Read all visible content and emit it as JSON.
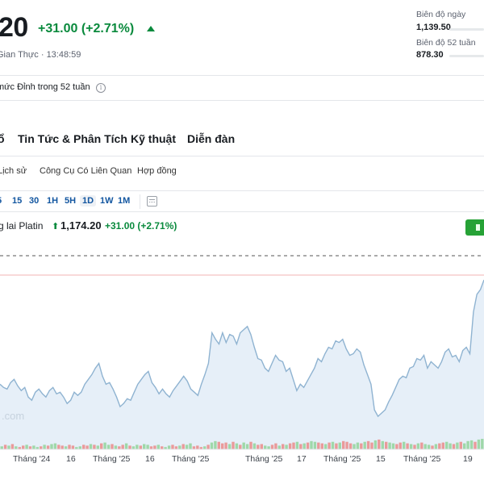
{
  "header": {
    "price_fragment": "20",
    "change": "+31.00 (+2.71%)",
    "realtime_label": "Gian Thực · 13:48:59",
    "day_range": {
      "label": "Biên độ ngày",
      "value": "1,139.50"
    },
    "week52_range": {
      "label": "Biên độ 52 tuần",
      "value": "878.30"
    },
    "high_notice": "mức Đỉnh trong 52 tuần",
    "info_icon_glyph": "i"
  },
  "main_tabs": [
    "ổ",
    "Tin Tức & Phân Tích",
    "Kỹ thuật",
    "Diễn đàn"
  ],
  "sub_tabs": [
    "Lịch sử",
    "Công Cụ Có Liên Quan",
    "Hợp đồng"
  ],
  "intervals": [
    {
      "label": "5",
      "active": false
    },
    {
      "label": "15",
      "active": false
    },
    {
      "label": "30",
      "active": false
    },
    {
      "label": "1H",
      "active": false
    },
    {
      "label": "5H",
      "active": false
    },
    {
      "label": "1D",
      "active": true
    },
    {
      "label": "1W",
      "active": false
    },
    {
      "label": "1M",
      "active": false
    }
  ],
  "chart_legend": {
    "name": "g lai Platin",
    "arrow": "⬆",
    "price": "1,174.20",
    "change": "+31.00 (+2.71%)"
  },
  "watermark": ".com",
  "colors": {
    "up": "#0a8a3d",
    "line": "#8fb3d1",
    "area": "#e6eff8",
    "vol_up": "#9fd8a9",
    "vol_down": "#ea9a9a",
    "button": "#26a236"
  },
  "chart_data": {
    "type": "area",
    "x_tick_labels": [
      "Tháng '24",
      "16",
      "Tháng '25",
      "16",
      "Tháng '25",
      "Tháng '25",
      "17",
      "Tháng '25",
      "15",
      "Tháng '25",
      "19"
    ],
    "values": [
      52,
      50,
      49,
      53,
      55,
      51,
      48,
      50,
      44,
      42,
      47,
      49,
      46,
      44,
      48,
      50,
      46,
      47,
      44,
      40,
      42,
      47,
      45,
      47,
      52,
      55,
      58,
      62,
      65,
      57,
      52,
      53,
      49,
      44,
      38,
      40,
      43,
      42,
      47,
      52,
      55,
      58,
      60,
      53,
      50,
      46,
      49,
      46,
      44,
      48,
      51,
      54,
      57,
      54,
      49,
      47,
      45,
      52,
      58,
      65,
      84,
      80,
      77,
      84,
      78,
      83,
      82,
      77,
      84,
      86,
      88,
      83,
      75,
      68,
      67,
      62,
      60,
      65,
      70,
      67,
      66,
      60,
      62,
      55,
      48,
      52,
      50,
      54,
      58,
      62,
      68,
      66,
      71,
      75,
      74,
      79,
      78,
      80,
      74,
      70,
      71,
      74,
      72,
      64,
      58,
      52,
      36,
      32,
      34,
      36,
      41,
      45,
      50,
      55,
      57,
      56,
      62,
      63,
      68,
      67,
      70,
      62,
      66,
      64,
      62,
      66,
      72,
      74,
      69,
      70,
      66,
      73,
      75,
      71,
      97,
      108,
      111,
      117
    ],
    "y_range": [
      25,
      120
    ],
    "volume_colors": "g,r,g,r,g,r,r,g,r,g,g,r,g,r,g,g,r,r,g,r,r,g,g,r,r,g,r,g,r,g,g,r,g,r,r,g,r,g,g,r,g,g,r,r,g,r,g,g,r,r,g,r,g,g,r,r,r,g,r,g,g,r,r,r,g,r,g,r,g,g,r,g,r,r,g,g,r,r,g,r,g,r,r,g,r,g,r,g,g,r,r,g,r,g,r,g,r,r,r,g,g,r,g,r,r,g,r,g,r,g,g,r,r,g,r,g,r,g,r,g,g,r,g,r,r,g,g,r,g,r,g,g,g,r,g,g,g",
    "volumes": [
      4,
      6,
      5,
      7,
      4,
      3,
      5,
      6,
      4,
      5,
      3,
      4,
      6,
      5,
      7,
      8,
      6,
      5,
      4,
      6,
      5,
      3,
      4,
      6,
      5,
      7,
      6,
      5,
      8,
      9,
      6,
      7,
      5,
      4,
      6,
      8,
      5,
      4,
      6,
      5,
      7,
      6,
      4,
      5,
      6,
      4,
      3,
      5,
      6,
      4,
      5,
      7,
      6,
      8,
      4,
      5,
      3,
      4,
      6,
      9,
      11,
      10,
      8,
      9,
      7,
      10,
      8,
      6,
      9,
      7,
      10,
      8,
      6,
      7,
      5,
      4,
      6,
      8,
      5,
      7,
      6,
      8,
      9,
      10,
      7,
      8,
      9,
      11,
      10,
      9,
      8,
      7,
      9,
      10,
      8,
      9,
      11,
      10,
      8,
      7,
      9,
      8,
      10,
      11,
      9,
      12,
      13,
      11,
      10,
      9,
      8,
      7,
      9,
      10,
      8,
      7,
      6,
      8,
      9,
      7,
      6,
      5,
      7,
      8,
      9,
      10,
      8,
      7,
      9,
      10,
      8,
      11,
      12,
      10,
      13,
      14
    ]
  }
}
